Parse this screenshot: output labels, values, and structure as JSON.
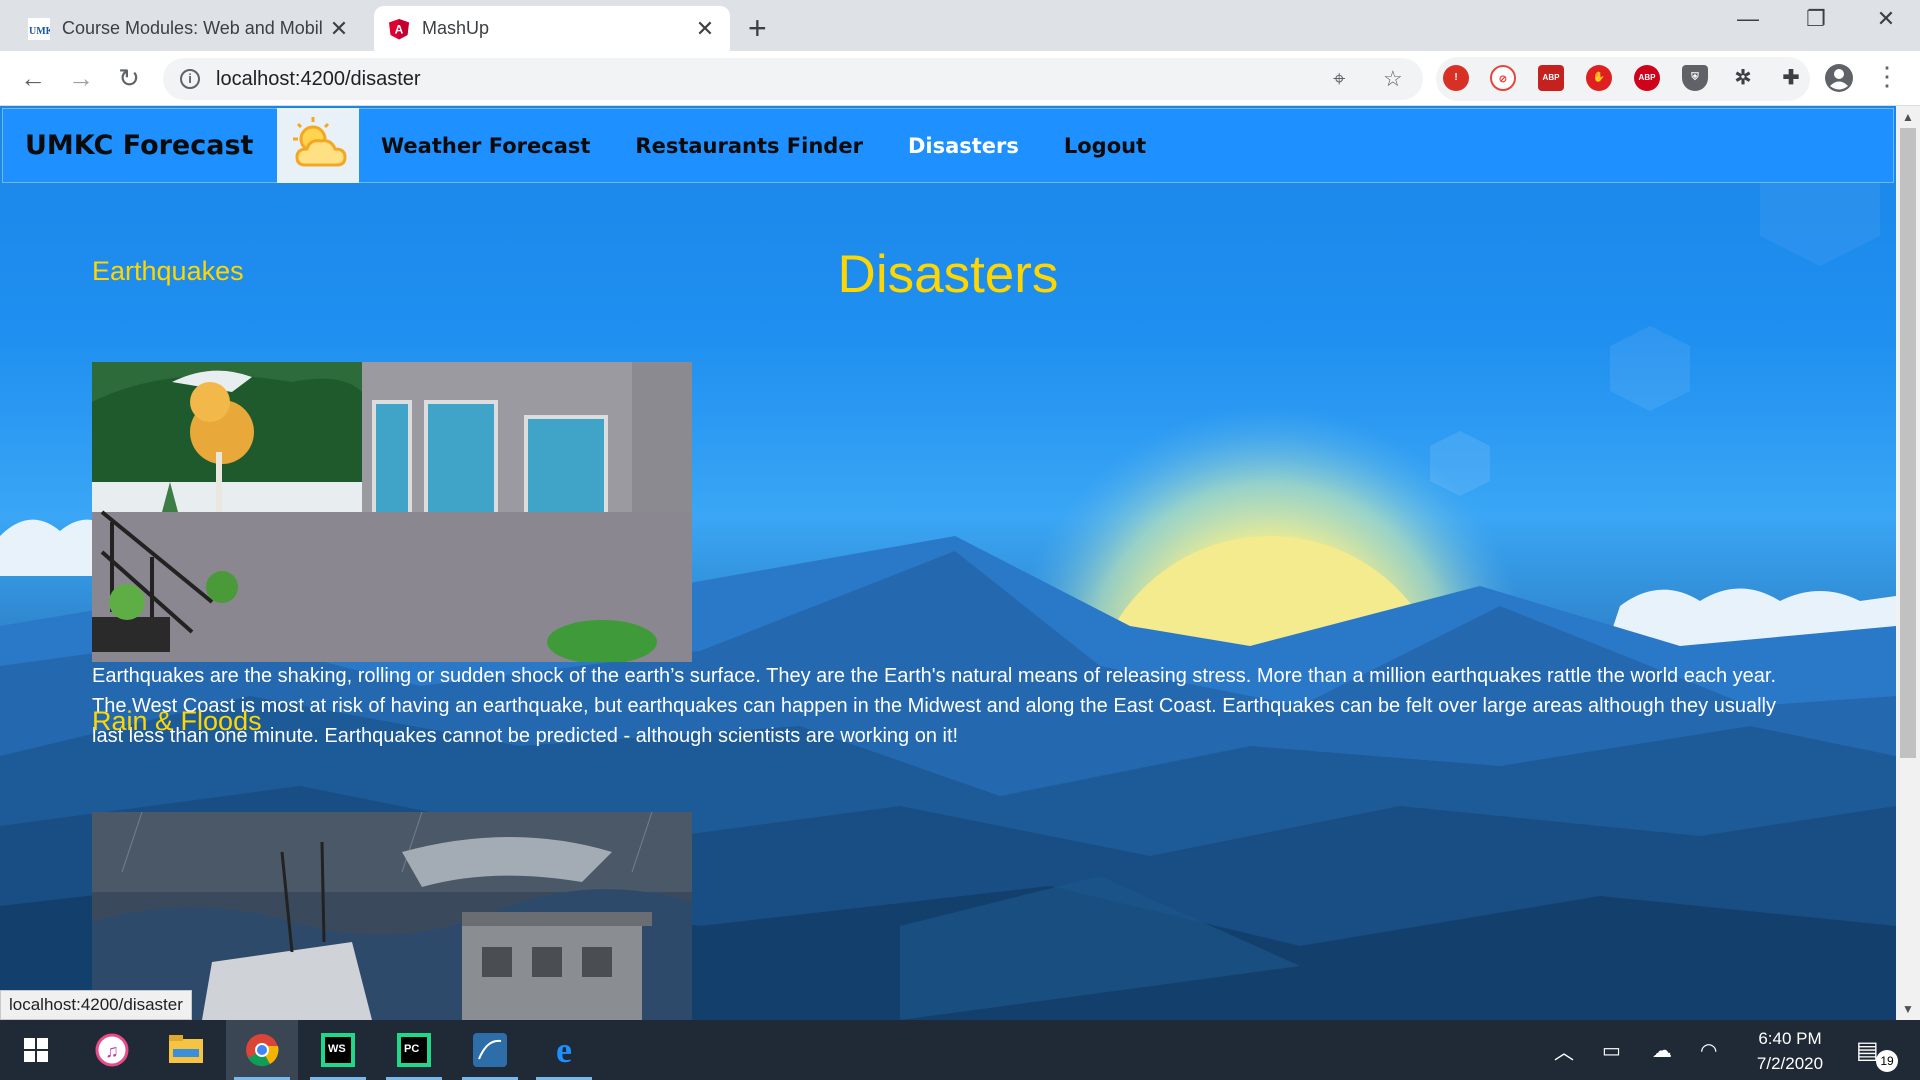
{
  "browser": {
    "tabs": [
      {
        "title": "Course Modules: Web and Mobil",
        "favicon": "umkc-icon",
        "active": false
      },
      {
        "title": "MashUp",
        "favicon": "angular-icon",
        "active": true
      }
    ],
    "url": "localhost:4200/disaster",
    "status_url": "localhost:4200/disaster",
    "extensions": [
      "extension-red-icon",
      "extension-pinwheel-icon",
      "abp-icon",
      "stop-icon",
      "abp-icon",
      "shield-icon",
      "bug-icon",
      "puzzle-icon"
    ],
    "ext_labels": {
      "abp_small": "ABP",
      "abp": "ABP"
    }
  },
  "app": {
    "brand": "UMKC Forecast",
    "nav": [
      {
        "label": "Weather Forecast",
        "active": false
      },
      {
        "label": "Restaurants Finder",
        "active": false
      },
      {
        "label": "Disasters",
        "active": true
      },
      {
        "label": "Logout",
        "active": false
      }
    ],
    "heading": "Disasters",
    "sections": [
      {
        "title": "Earthquakes",
        "image": "earthquake-scene-image",
        "description": "Earthquakes are the shaking, rolling or sudden shock of the earth’s surface. They are the Earth's natural means of releasing stress. More than a million earthquakes rattle the world each year. The West Coast is most at risk of having an earthquake, but earthquakes can happen in the Midwest and along the East Coast. Earthquakes can be felt over large areas although they usually last less than one minute. Earthquakes cannot be predicted - although scientists are working on it!"
      },
      {
        "title": "Rain & Floods",
        "image": "flood-scene-image"
      }
    ]
  },
  "taskbar": {
    "apps": [
      "windows-start-icon",
      "itunes-icon",
      "file-explorer-icon",
      "chrome-icon",
      "webstorm-icon",
      "pycharm-icon",
      "mysql-workbench-icon",
      "edge-icon"
    ],
    "app_labels": {
      "webstorm": "WS",
      "pycharm": "PC"
    },
    "time": "6:40 PM",
    "date": "7/2/2020",
    "notifications": "19"
  },
  "colors": {
    "navbar": "#1e90ff",
    "heading": "#ffd600",
    "active_nav": "#ffffff"
  }
}
